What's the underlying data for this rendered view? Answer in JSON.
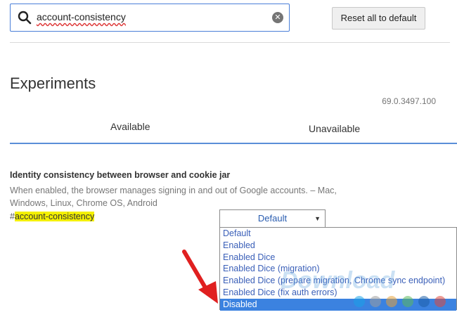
{
  "search": {
    "query": "account-consistency"
  },
  "toolbar": {
    "reset_label": "Reset all to default"
  },
  "page": {
    "title": "Experiments",
    "version": "69.0.3497.100"
  },
  "tabs": [
    {
      "label": "Available"
    },
    {
      "label": "Unavailable"
    }
  ],
  "experiment": {
    "title": "Identity consistency between browser and cookie jar",
    "description": "When enabled, the browser manages signing in and out of Google accounts. – Mac, Windows, Linux, Chrome OS, Android",
    "hash": "#",
    "link": "account-consistency",
    "selected_value": "Default",
    "options": [
      "Default",
      "Enabled",
      "Enabled Dice",
      "Enabled Dice (migration)",
      "Enabled Dice (prepare migration, Chrome sync endpoint)",
      "Enabled Dice (fix auth errors)",
      "Disabled"
    ],
    "highlighted_option": "Disabled"
  },
  "watermark": {
    "text": "Download.com.vn",
    "dot_colors": [
      "#1aa3e8",
      "#9e9e9e",
      "#e8a33a",
      "#5cb85c",
      "#1e5fa8",
      "#e0483a"
    ]
  },
  "icons": {
    "search": "search-icon",
    "clear": "clear-icon",
    "dropdown": "chevron-down-icon",
    "annotation": "red-arrow-icon"
  },
  "colors": {
    "accent": "#3b82e0",
    "highlight": "#f4f000",
    "annotation": "#e02020"
  }
}
